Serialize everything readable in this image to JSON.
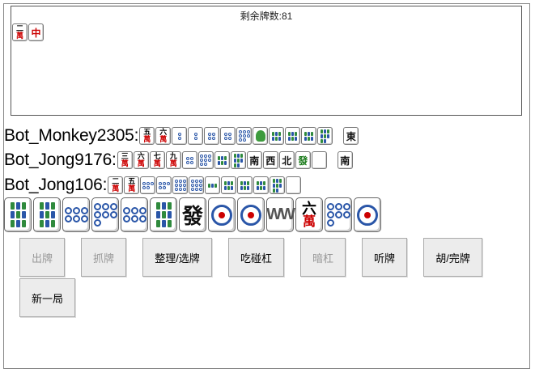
{
  "discard_area": {
    "remaining_label": "剩余牌数:81",
    "tiles": [
      {
        "kind": "wan",
        "num": "二",
        "wan": "萬"
      },
      {
        "kind": "glyph",
        "text": "中",
        "color": "red"
      }
    ]
  },
  "players": [
    {
      "name": "Bot_Monkey2305:",
      "tiles": [
        {
          "kind": "wan",
          "num": "五",
          "wan": "萬"
        },
        {
          "kind": "wan",
          "num": "六",
          "wan": "萬"
        },
        {
          "kind": "dots",
          "count": 2
        },
        {
          "kind": "dots",
          "count": 2
        },
        {
          "kind": "dots",
          "count": 4
        },
        {
          "kind": "dots",
          "count": 4
        },
        {
          "kind": "dots",
          "count": 8
        },
        {
          "kind": "bird"
        },
        {
          "kind": "bams",
          "count": 6
        },
        {
          "kind": "bams",
          "count": 6
        },
        {
          "kind": "bams",
          "count": 6
        },
        {
          "kind": "bams",
          "count": 8
        },
        {
          "kind": "glyph",
          "text": "東",
          "color": "black",
          "gap": true
        }
      ]
    },
    {
      "name": "Bot_Jong9176:",
      "tiles": [
        {
          "kind": "wan",
          "num": "三",
          "wan": "萬"
        },
        {
          "kind": "wan",
          "num": "六",
          "wan": "萬"
        },
        {
          "kind": "wan",
          "num": "七",
          "wan": "萬"
        },
        {
          "kind": "wan",
          "num": "九",
          "wan": "萬"
        },
        {
          "kind": "dots",
          "count": 4
        },
        {
          "kind": "dots",
          "count": 8
        },
        {
          "kind": "bams",
          "count": 6
        },
        {
          "kind": "bams",
          "count": 8
        },
        {
          "kind": "glyph",
          "text": "南",
          "color": "black"
        },
        {
          "kind": "glyph",
          "text": "西",
          "color": "black"
        },
        {
          "kind": "glyph",
          "text": "北",
          "color": "black"
        },
        {
          "kind": "glyph",
          "text": "發",
          "color": "green"
        },
        {
          "kind": "blank"
        },
        {
          "kind": "glyph",
          "text": "南",
          "color": "black",
          "gap": true
        }
      ]
    },
    {
      "name": "Bot_Jong106:",
      "tiles": [
        {
          "kind": "wan",
          "num": "二",
          "wan": "萬"
        },
        {
          "kind": "wan",
          "num": "五",
          "wan": "萬"
        },
        {
          "kind": "dots",
          "count": 5
        },
        {
          "kind": "dots",
          "count": 5
        },
        {
          "kind": "dots",
          "count": 9
        },
        {
          "kind": "dots",
          "count": 9
        },
        {
          "kind": "bams",
          "count": 3
        },
        {
          "kind": "bams",
          "count": 6
        },
        {
          "kind": "bams",
          "count": 6
        },
        {
          "kind": "bams",
          "count": 6
        },
        {
          "kind": "bams",
          "count": 8
        },
        {
          "kind": "blank"
        }
      ]
    }
  ],
  "hand": [
    {
      "kind": "bams",
      "count": 9
    },
    {
      "kind": "bams",
      "count": 9
    },
    {
      "kind": "dots",
      "count": 6
    },
    {
      "kind": "dots",
      "count": 7
    },
    {
      "kind": "dots",
      "count": 6
    },
    {
      "kind": "bams",
      "count": 9
    },
    {
      "kind": "glyph",
      "text": "發",
      "color": "black"
    },
    {
      "kind": "bigdot"
    },
    {
      "kind": "bigdot"
    },
    {
      "kind": "wchar"
    },
    {
      "kind": "wan",
      "num": "六",
      "wan": "萬"
    },
    {
      "kind": "dots",
      "count": 7
    },
    {
      "kind": "bigdot"
    }
  ],
  "buttons": {
    "discard": "出牌",
    "draw": "抓牌",
    "sort": "整理/选牌",
    "chi_peng_gang": "吃碰杠",
    "an_gang": "暗杠",
    "ting": "听牌",
    "hu": "胡/完牌",
    "new_game": "新一局"
  },
  "colors": {
    "wan_red": "#cc0000",
    "dot_blue": "#2a56a8",
    "bam_green": "#2f8a3d",
    "fa_green": "#1a7a1a",
    "button_bg": "#ececec",
    "disabled_text": "#999999"
  }
}
